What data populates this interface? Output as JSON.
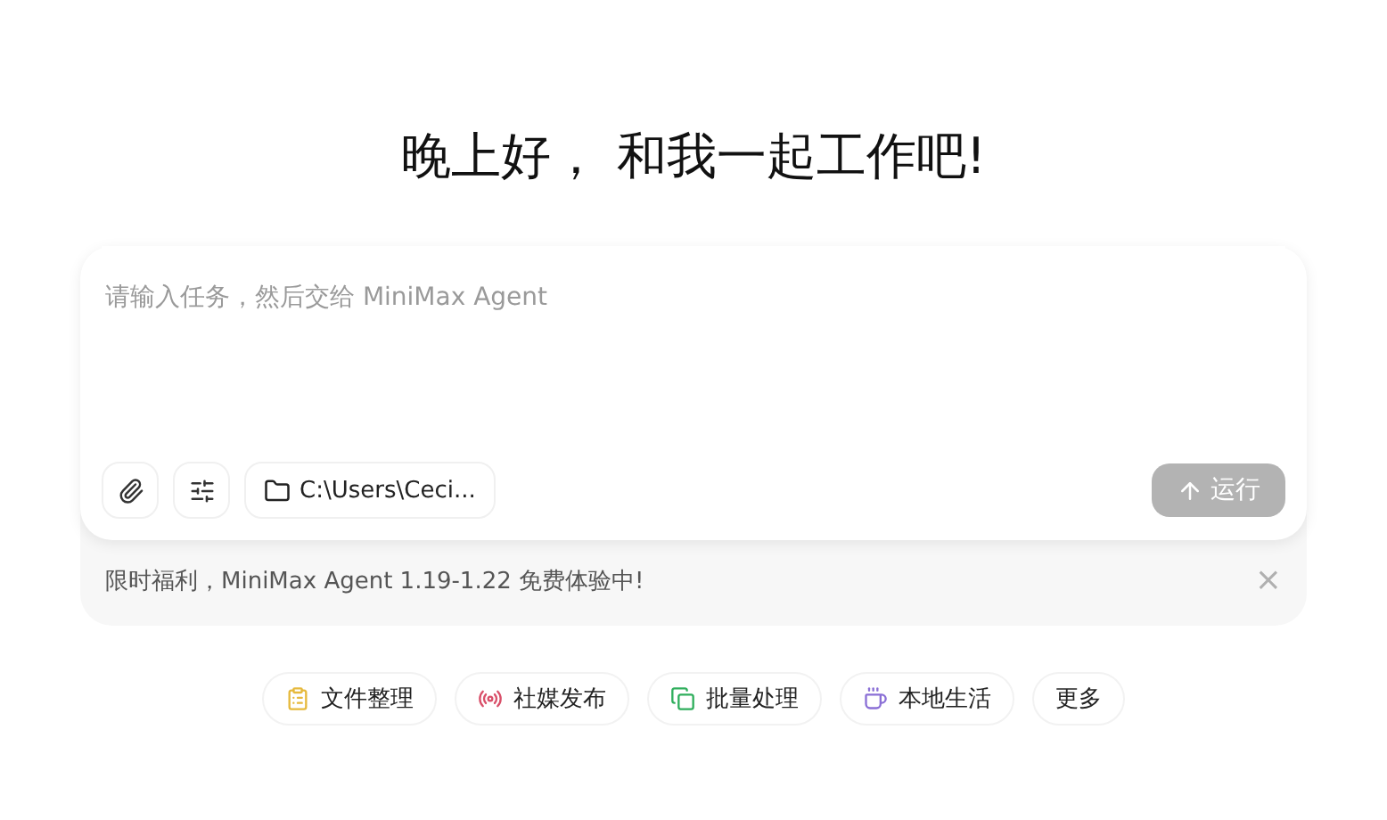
{
  "greeting": "晚上好， 和我一起工作吧!",
  "composer": {
    "placeholder": "请输入任务，然后交给 MiniMax Agent",
    "folder": "C:\\Users\\Ceci...",
    "run_button": {
      "label": "运行",
      "disabled": true
    }
  },
  "promo": {
    "text": "限时福利，MiniMax Agent 1.19-1.22 免费体验中!",
    "close": "×"
  },
  "chips": [
    {
      "kind": "clipboard",
      "label": "文件整理",
      "color": "#e6b93c"
    },
    {
      "kind": "broadcast",
      "label": "社媒发布",
      "color": "#d9506a"
    },
    {
      "kind": "copy",
      "label": "批量处理",
      "color": "#2fae5c"
    },
    {
      "kind": "cup",
      "label": "本地生活",
      "color": "#8a6fd6"
    },
    {
      "kind": "none",
      "label": "更多"
    }
  ]
}
